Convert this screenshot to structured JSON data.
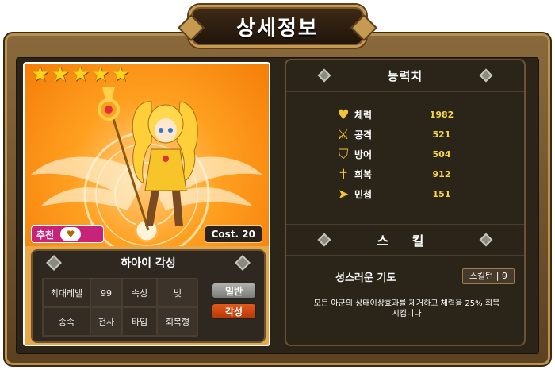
{
  "title": "상세정보",
  "card": {
    "stars": 5,
    "recommend_label": "추천",
    "cost": "Cost. 20",
    "name": "하아이 각성",
    "info": [
      {
        "label": "최대레벨",
        "value": "99"
      },
      {
        "label": "속성",
        "value": "빛"
      },
      {
        "label": "종족",
        "value": "천사"
      },
      {
        "label": "타입",
        "value": "회복형"
      }
    ],
    "modes": [
      "일반",
      "각성"
    ]
  },
  "ability": {
    "title": "능력치",
    "stats": [
      {
        "label": "체력",
        "value": "1982",
        "icon": "heart-icon"
      },
      {
        "label": "공격",
        "value": "521",
        "icon": "sword-icon"
      },
      {
        "label": "방어",
        "value": "504",
        "icon": "shield-icon"
      },
      {
        "label": "회복",
        "value": "912",
        "icon": "cross-icon"
      },
      {
        "label": "민첩",
        "value": "151",
        "icon": "boot-icon"
      }
    ]
  },
  "skill": {
    "title": "스 킬",
    "name": "성스러운 기도",
    "cooldown": "스킬턴 | 9",
    "description_line1": "모든 아군의 상태이상효과를 제거하고 체력을 25% 회복",
    "description_line2": "시킵니다"
  },
  "colors": {
    "frame": "#8a6a3c",
    "panel": "#2a2419",
    "accent_gold": "#f5d54a",
    "recommend": "#c8237a",
    "awaken": "#e25a1a"
  }
}
